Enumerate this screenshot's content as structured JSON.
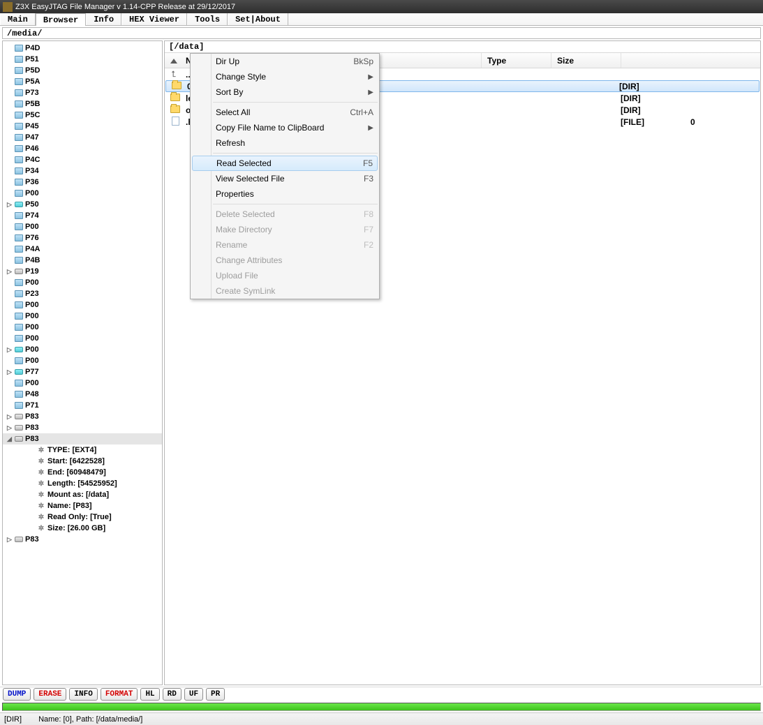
{
  "title": "Z3X EasyJTAG File Manager v 1.14-CPP Release at 29/12/2017",
  "tabs": [
    "Main",
    "Browser",
    "Info",
    "HEX Viewer",
    "Tools",
    "Set|About"
  ],
  "active_tab": 1,
  "crumb": "/media/",
  "right_path": "[/data]",
  "columns": {
    "name": "Name",
    "type": "Type",
    "size": "Size"
  },
  "tree": [
    {
      "label": "P4D",
      "icon": "chip"
    },
    {
      "label": "P51",
      "icon": "chip"
    },
    {
      "label": "P5D",
      "icon": "chip"
    },
    {
      "label": "P5A",
      "icon": "chip"
    },
    {
      "label": "P73",
      "icon": "chip"
    },
    {
      "label": "P5B",
      "icon": "chip"
    },
    {
      "label": "P5C",
      "icon": "chip"
    },
    {
      "label": "P45",
      "icon": "chip"
    },
    {
      "label": "P47",
      "icon": "chip"
    },
    {
      "label": "P46",
      "icon": "chip"
    },
    {
      "label": "P4C",
      "icon": "chip"
    },
    {
      "label": "P34",
      "icon": "chip"
    },
    {
      "label": "P36",
      "icon": "chip"
    },
    {
      "label": "P00",
      "icon": "chip"
    },
    {
      "label": "P50",
      "icon": "hdd",
      "exp": "closed"
    },
    {
      "label": "P74",
      "icon": "chip"
    },
    {
      "label": "P00",
      "icon": "chip"
    },
    {
      "label": "P76",
      "icon": "chip"
    },
    {
      "label": "P4A",
      "icon": "chip"
    },
    {
      "label": "P4B",
      "icon": "chip"
    },
    {
      "label": "P19",
      "icon": "drive",
      "exp": "closed"
    },
    {
      "label": "P00",
      "icon": "chip"
    },
    {
      "label": "P23",
      "icon": "chip"
    },
    {
      "label": "P00",
      "icon": "chip"
    },
    {
      "label": "P00",
      "icon": "chip"
    },
    {
      "label": "P00",
      "icon": "chip"
    },
    {
      "label": "P00",
      "icon": "chip"
    },
    {
      "label": "P00",
      "icon": "hdd",
      "exp": "closed"
    },
    {
      "label": "P00",
      "icon": "chip"
    },
    {
      "label": "P77",
      "icon": "hdd",
      "exp": "closed"
    },
    {
      "label": "P00",
      "icon": "chip"
    },
    {
      "label": "P48",
      "icon": "chip"
    },
    {
      "label": "P71",
      "icon": "chip"
    },
    {
      "label": "P83",
      "icon": "drive",
      "exp": "closed"
    },
    {
      "label": "P83",
      "icon": "drive",
      "exp": "closed"
    },
    {
      "label": "P83",
      "icon": "drive",
      "exp": "open",
      "selected": true
    },
    {
      "label": "TYPE: [EXT4]",
      "icon": "gear",
      "indent": 2
    },
    {
      "label": "Start: [6422528]",
      "icon": "gear",
      "indent": 2
    },
    {
      "label": "End: [60948479]",
      "icon": "gear",
      "indent": 2
    },
    {
      "label": "Length:  [54525952]",
      "icon": "gear",
      "indent": 2
    },
    {
      "label": "Mount as:  [/data]",
      "icon": "gear",
      "indent": 2
    },
    {
      "label": "Name:  [P83]",
      "icon": "gear",
      "indent": 2
    },
    {
      "label": "Read Only:  [True]",
      "icon": "gear",
      "indent": 2
    },
    {
      "label": "Size:  [26.00 GB]",
      "icon": "gear",
      "indent": 2
    },
    {
      "label": "P83",
      "icon": "drive",
      "exp": "closed"
    }
  ],
  "files": [
    {
      "name": "..",
      "type": "",
      "size": "",
      "icon": "up"
    },
    {
      "name": "0",
      "type": "[DIR]",
      "size": "",
      "icon": "folder",
      "selected": true
    },
    {
      "name": "le",
      "type": "[DIR]",
      "size": "",
      "icon": "folder"
    },
    {
      "name": "ol",
      "type": "[DIR]",
      "size": "",
      "icon": "folder"
    },
    {
      "name": ".h",
      "type": "[FILE]",
      "size": "0",
      "icon": "file"
    }
  ],
  "context_menu": [
    {
      "label": "Dir Up",
      "shortcut": "BkSp"
    },
    {
      "label": "Change Style",
      "submenu": true
    },
    {
      "label": "Sort By",
      "submenu": true
    },
    {
      "sep": true
    },
    {
      "label": "Select All",
      "shortcut": "Ctrl+A"
    },
    {
      "label": "Copy File Name to ClipBoard",
      "submenu": true
    },
    {
      "label": "Refresh"
    },
    {
      "sep": true
    },
    {
      "label": "Read Selected",
      "shortcut": "F5",
      "highlight": true
    },
    {
      "label": "View Selected File",
      "shortcut": "F3"
    },
    {
      "label": "Properties"
    },
    {
      "sep": true
    },
    {
      "label": "Delete Selected",
      "shortcut": "F8",
      "disabled": true
    },
    {
      "label": "Make Directory",
      "shortcut": "F7",
      "disabled": true
    },
    {
      "label": "Rename",
      "shortcut": "F2",
      "disabled": true
    },
    {
      "label": "Change Attributes",
      "disabled": true
    },
    {
      "label": "Upload File",
      "disabled": true
    },
    {
      "label": "Create SymLink",
      "disabled": true
    }
  ],
  "toolbar": [
    {
      "label": "DUMP",
      "cls": "blue"
    },
    {
      "label": "ERASE",
      "cls": "red"
    },
    {
      "label": "INFO",
      "cls": "blk"
    },
    {
      "label": "FORMAT",
      "cls": "red"
    },
    {
      "label": "HL",
      "cls": "blk"
    },
    {
      "label": "RD",
      "cls": "blk"
    },
    {
      "label": "UF",
      "cls": "blk"
    },
    {
      "label": "PR",
      "cls": "blk"
    }
  ],
  "status": {
    "left": "[DIR]",
    "right": "Name: [0], Path: [/data/media/]"
  }
}
